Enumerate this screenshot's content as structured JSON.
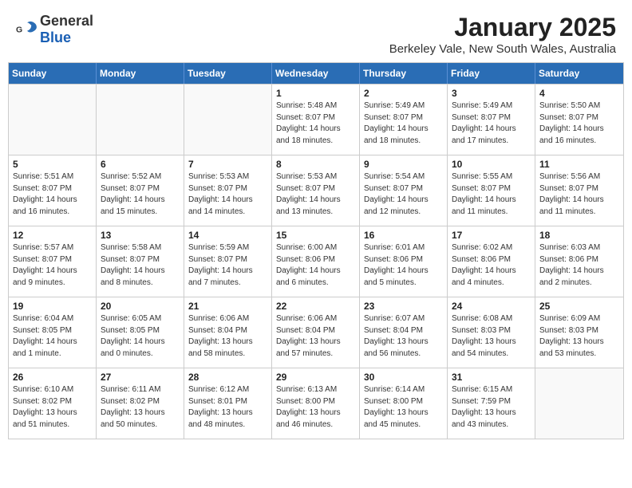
{
  "logo": {
    "general": "General",
    "blue": "Blue"
  },
  "title": "January 2025",
  "subtitle": "Berkeley Vale, New South Wales, Australia",
  "header_days": [
    "Sunday",
    "Monday",
    "Tuesday",
    "Wednesday",
    "Thursday",
    "Friday",
    "Saturday"
  ],
  "weeks": [
    [
      {
        "day": "",
        "info": "",
        "empty": true
      },
      {
        "day": "",
        "info": "",
        "empty": true
      },
      {
        "day": "",
        "info": "",
        "empty": true
      },
      {
        "day": "1",
        "info": "Sunrise: 5:48 AM\nSunset: 8:07 PM\nDaylight: 14 hours\nand 18 minutes.",
        "empty": false
      },
      {
        "day": "2",
        "info": "Sunrise: 5:49 AM\nSunset: 8:07 PM\nDaylight: 14 hours\nand 18 minutes.",
        "empty": false
      },
      {
        "day": "3",
        "info": "Sunrise: 5:49 AM\nSunset: 8:07 PM\nDaylight: 14 hours\nand 17 minutes.",
        "empty": false
      },
      {
        "day": "4",
        "info": "Sunrise: 5:50 AM\nSunset: 8:07 PM\nDaylight: 14 hours\nand 16 minutes.",
        "empty": false
      }
    ],
    [
      {
        "day": "5",
        "info": "Sunrise: 5:51 AM\nSunset: 8:07 PM\nDaylight: 14 hours\nand 16 minutes.",
        "empty": false
      },
      {
        "day": "6",
        "info": "Sunrise: 5:52 AM\nSunset: 8:07 PM\nDaylight: 14 hours\nand 15 minutes.",
        "empty": false
      },
      {
        "day": "7",
        "info": "Sunrise: 5:53 AM\nSunset: 8:07 PM\nDaylight: 14 hours\nand 14 minutes.",
        "empty": false
      },
      {
        "day": "8",
        "info": "Sunrise: 5:53 AM\nSunset: 8:07 PM\nDaylight: 14 hours\nand 13 minutes.",
        "empty": false
      },
      {
        "day": "9",
        "info": "Sunrise: 5:54 AM\nSunset: 8:07 PM\nDaylight: 14 hours\nand 12 minutes.",
        "empty": false
      },
      {
        "day": "10",
        "info": "Sunrise: 5:55 AM\nSunset: 8:07 PM\nDaylight: 14 hours\nand 11 minutes.",
        "empty": false
      },
      {
        "day": "11",
        "info": "Sunrise: 5:56 AM\nSunset: 8:07 PM\nDaylight: 14 hours\nand 11 minutes.",
        "empty": false
      }
    ],
    [
      {
        "day": "12",
        "info": "Sunrise: 5:57 AM\nSunset: 8:07 PM\nDaylight: 14 hours\nand 9 minutes.",
        "empty": false
      },
      {
        "day": "13",
        "info": "Sunrise: 5:58 AM\nSunset: 8:07 PM\nDaylight: 14 hours\nand 8 minutes.",
        "empty": false
      },
      {
        "day": "14",
        "info": "Sunrise: 5:59 AM\nSunset: 8:07 PM\nDaylight: 14 hours\nand 7 minutes.",
        "empty": false
      },
      {
        "day": "15",
        "info": "Sunrise: 6:00 AM\nSunset: 8:06 PM\nDaylight: 14 hours\nand 6 minutes.",
        "empty": false
      },
      {
        "day": "16",
        "info": "Sunrise: 6:01 AM\nSunset: 8:06 PM\nDaylight: 14 hours\nand 5 minutes.",
        "empty": false
      },
      {
        "day": "17",
        "info": "Sunrise: 6:02 AM\nSunset: 8:06 PM\nDaylight: 14 hours\nand 4 minutes.",
        "empty": false
      },
      {
        "day": "18",
        "info": "Sunrise: 6:03 AM\nSunset: 8:06 PM\nDaylight: 14 hours\nand 2 minutes.",
        "empty": false
      }
    ],
    [
      {
        "day": "19",
        "info": "Sunrise: 6:04 AM\nSunset: 8:05 PM\nDaylight: 14 hours\nand 1 minute.",
        "empty": false
      },
      {
        "day": "20",
        "info": "Sunrise: 6:05 AM\nSunset: 8:05 PM\nDaylight: 14 hours\nand 0 minutes.",
        "empty": false
      },
      {
        "day": "21",
        "info": "Sunrise: 6:06 AM\nSunset: 8:04 PM\nDaylight: 13 hours\nand 58 minutes.",
        "empty": false
      },
      {
        "day": "22",
        "info": "Sunrise: 6:06 AM\nSunset: 8:04 PM\nDaylight: 13 hours\nand 57 minutes.",
        "empty": false
      },
      {
        "day": "23",
        "info": "Sunrise: 6:07 AM\nSunset: 8:04 PM\nDaylight: 13 hours\nand 56 minutes.",
        "empty": false
      },
      {
        "day": "24",
        "info": "Sunrise: 6:08 AM\nSunset: 8:03 PM\nDaylight: 13 hours\nand 54 minutes.",
        "empty": false
      },
      {
        "day": "25",
        "info": "Sunrise: 6:09 AM\nSunset: 8:03 PM\nDaylight: 13 hours\nand 53 minutes.",
        "empty": false
      }
    ],
    [
      {
        "day": "26",
        "info": "Sunrise: 6:10 AM\nSunset: 8:02 PM\nDaylight: 13 hours\nand 51 minutes.",
        "empty": false
      },
      {
        "day": "27",
        "info": "Sunrise: 6:11 AM\nSunset: 8:02 PM\nDaylight: 13 hours\nand 50 minutes.",
        "empty": false
      },
      {
        "day": "28",
        "info": "Sunrise: 6:12 AM\nSunset: 8:01 PM\nDaylight: 13 hours\nand 48 minutes.",
        "empty": false
      },
      {
        "day": "29",
        "info": "Sunrise: 6:13 AM\nSunset: 8:00 PM\nDaylight: 13 hours\nand 46 minutes.",
        "empty": false
      },
      {
        "day": "30",
        "info": "Sunrise: 6:14 AM\nSunset: 8:00 PM\nDaylight: 13 hours\nand 45 minutes.",
        "empty": false
      },
      {
        "day": "31",
        "info": "Sunrise: 6:15 AM\nSunset: 7:59 PM\nDaylight: 13 hours\nand 43 minutes.",
        "empty": false
      },
      {
        "day": "",
        "info": "",
        "empty": true
      }
    ]
  ]
}
